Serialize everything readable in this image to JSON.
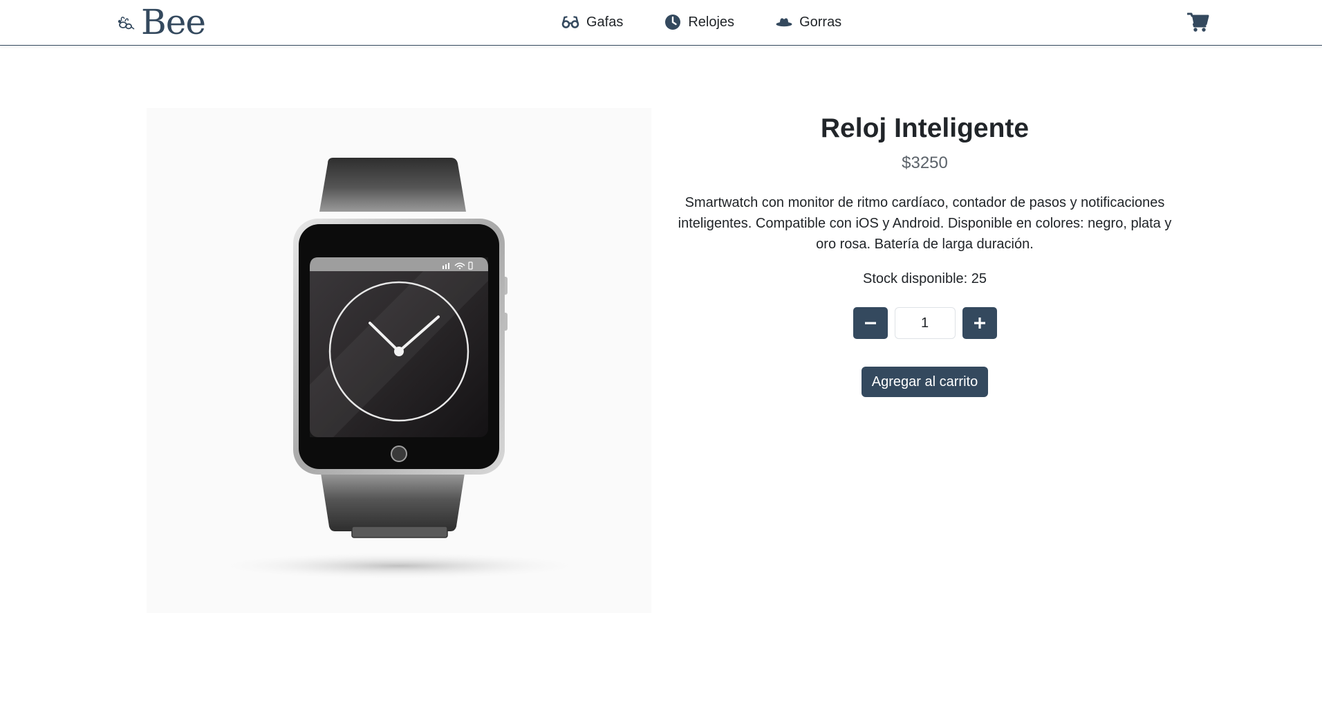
{
  "brand": {
    "name": "Bee",
    "logo_icon": "bee-icon"
  },
  "nav": {
    "items": [
      {
        "label": "Gafas",
        "icon": "glasses-icon"
      },
      {
        "label": "Relojes",
        "icon": "clock-icon"
      },
      {
        "label": "Gorras",
        "icon": "hat-icon"
      }
    ],
    "cart_icon": "cart-icon"
  },
  "colors": {
    "accent": "#34495e",
    "text": "#212529",
    "muted": "#5c636a"
  },
  "product": {
    "title": "Reloj Inteligente",
    "price": "$3250",
    "description": "Smartwatch con monitor de ritmo cardíaco, contador de pasos y notificaciones inteligentes. Compatible con iOS y Android. Disponible en colores: negro, plata y oro rosa. Batería de larga duración.",
    "stock_text": "Stock disponible: 25",
    "quantity": "1",
    "add_to_cart_label": "Agregar al carrito"
  }
}
